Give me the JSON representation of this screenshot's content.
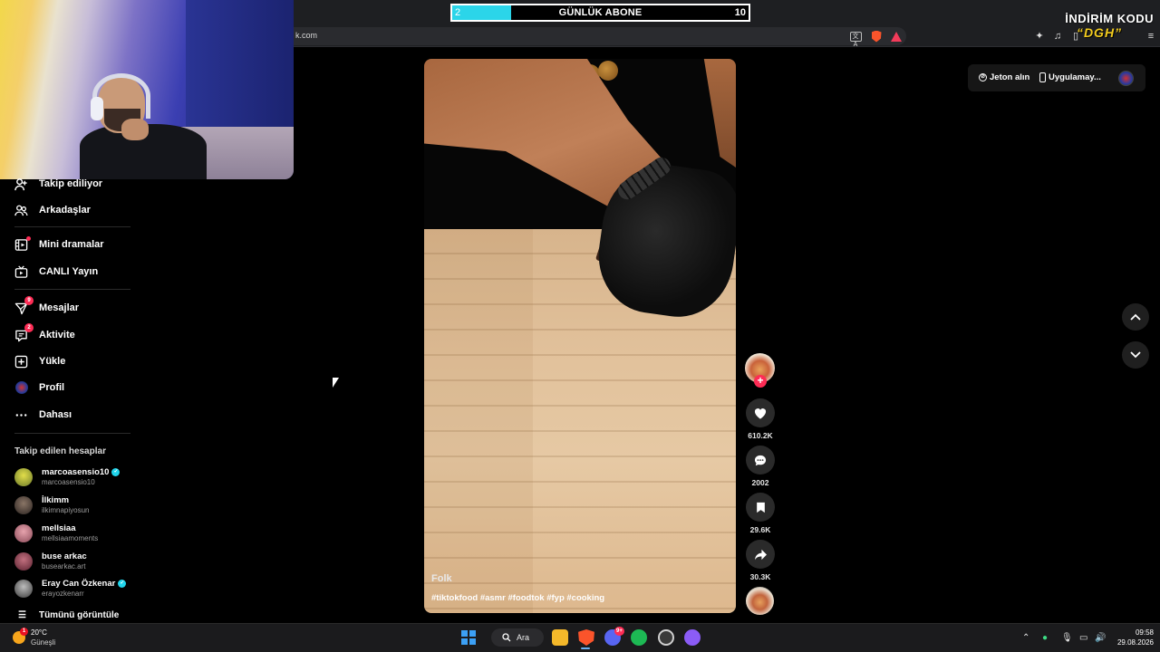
{
  "browser": {
    "url_visible": "k.com",
    "ext_icons": [
      "puzzle-icon",
      "music-icon",
      "sidebar-icon",
      "profile-icon",
      "shield-vpn-icon",
      "menu-icon"
    ]
  },
  "overlay": {
    "sub_goal": {
      "current": "2",
      "label": "GÜNLÜK ABONE",
      "target": "10",
      "progress": 0.2
    },
    "promo_line1": "İNDİRİM KODU",
    "promo_line2": "“DGH”"
  },
  "sidebar": {
    "nav": [
      {
        "label": "Takip ediliyor",
        "icon": "following-icon"
      },
      {
        "label": "Arkadaşlar",
        "icon": "friends-icon"
      },
      {
        "label": "Mini dramalar",
        "icon": "mini-drama-icon"
      },
      {
        "label": "CANLI Yayın",
        "icon": "live-icon"
      },
      {
        "label": "Mesajlar",
        "icon": "messages-icon",
        "badge": "9"
      },
      {
        "label": "Aktivite",
        "icon": "activity-icon",
        "badge": "2"
      },
      {
        "label": "Yükle",
        "icon": "upload-icon"
      },
      {
        "label": "Profil",
        "icon": "profile-avatar"
      },
      {
        "label": "Dahası",
        "icon": "more-icon"
      }
    ],
    "following_title": "Takip edilen hesaplar",
    "accounts": [
      {
        "name": "marcoasensio10",
        "handle": "marcoasensio10",
        "verified": true,
        "color": "#c6c238"
      },
      {
        "name": "İlkimm",
        "handle": "ilkimnapiyosun",
        "verified": false,
        "color": "#6b5a4e"
      },
      {
        "name": "mellsiaa",
        "handle": "mellsiaamoments",
        "verified": false,
        "color": "#c8808a"
      },
      {
        "name": "buse arkac",
        "handle": "busearkac.art",
        "verified": false,
        "color": "#a04a5a"
      },
      {
        "name": "Eray Can Özkenar",
        "handle": "erayozkenarr",
        "verified": true,
        "color": "#8a8a8a"
      }
    ],
    "see_all": "Tümünü görüntüle"
  },
  "video": {
    "author": "Folk",
    "caption": "#tiktokfood #asmr #foodtok #fyp #cooking"
  },
  "actions": {
    "likes": "610.2K",
    "comments": "2002",
    "saves": "29.6K",
    "shares": "30.3K"
  },
  "top_right": {
    "coins": "Jeton alın",
    "app": "Uygulamay..."
  },
  "taskbar": {
    "weather_temp": "20°C",
    "weather_desc": "Güneşli",
    "weather_badge": "1",
    "search": "Ara",
    "discord_badge": "9+",
    "time": "09:58",
    "date": "29.08.2026"
  }
}
